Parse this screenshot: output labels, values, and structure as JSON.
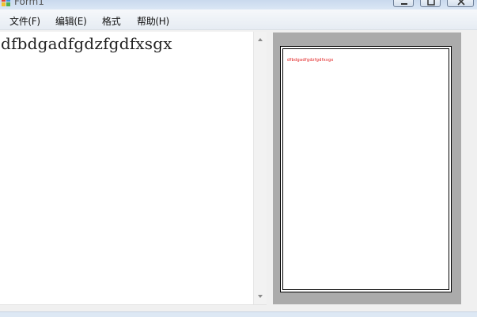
{
  "window": {
    "title": "Form1",
    "icon": "app-icon",
    "controls": [
      "minimize-icon",
      "maximize-icon",
      "close-icon"
    ]
  },
  "menubar": {
    "items": [
      {
        "label": "文件(F)"
      },
      {
        "label": "编辑(E)"
      },
      {
        "label": "格式"
      },
      {
        "label": "帮助(H)"
      }
    ]
  },
  "editor": {
    "text": "dfbdgadfgdzfgdfxsgx"
  },
  "preview": {
    "text": "dfbdgadfgdzfgdfxsgx",
    "text_color": "#e01010",
    "background_color": "#ababab"
  }
}
